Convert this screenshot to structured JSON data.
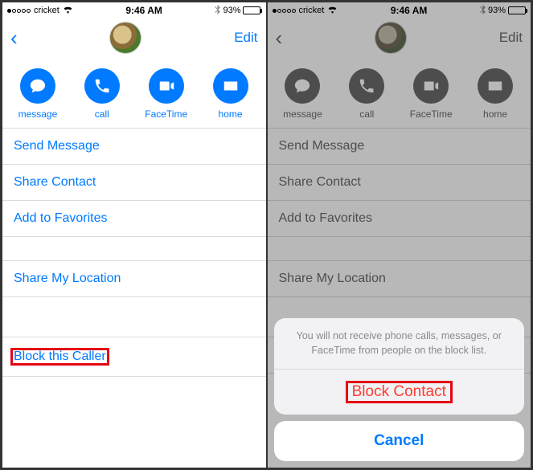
{
  "status": {
    "carrier": "cricket",
    "time": "9:46 AM",
    "battery_pct": "93%"
  },
  "nav": {
    "edit": "Edit"
  },
  "actions": {
    "message": "message",
    "call": "call",
    "facetime": "FaceTime",
    "home": "home"
  },
  "rows": {
    "send_message": "Send Message",
    "share_contact": "Share Contact",
    "add_favorites": "Add to Favorites",
    "share_location": "Share My Location",
    "block_caller": "Block this Caller"
  },
  "sheet": {
    "message": "You will not receive phone calls, messages, or FaceTime from people on the block list.",
    "block": "Block Contact",
    "cancel": "Cancel"
  }
}
